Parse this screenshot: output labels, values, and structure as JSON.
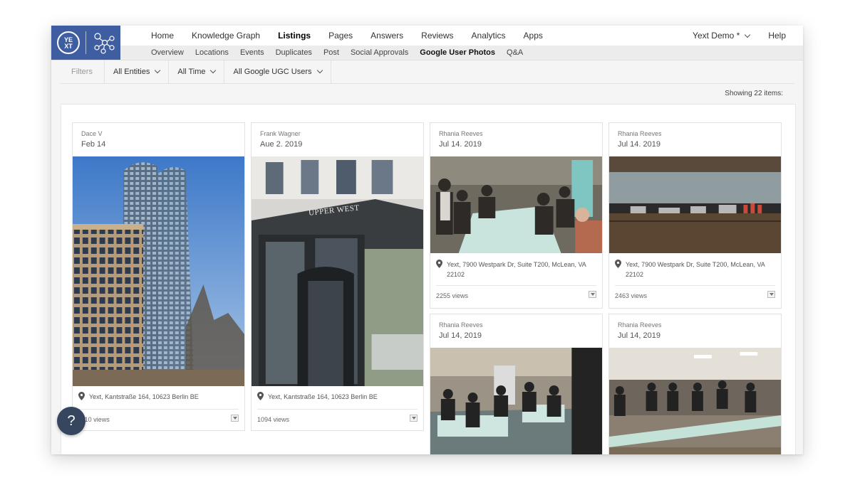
{
  "nav": {
    "main": [
      "Home",
      "Knowledge Graph",
      "Listings",
      "Pages",
      "Answers",
      "Reviews",
      "Analytics",
      "Apps"
    ],
    "active_main": "Listings",
    "sub": [
      "Overview",
      "Locations",
      "Events",
      "Duplicates",
      "Post",
      "Social Approvals",
      "Google User Photos",
      "Q&A"
    ],
    "active_sub": "Google User Photos",
    "account": "Yext Demo *",
    "help": "Help"
  },
  "filters": {
    "label": "Filters",
    "entities": "All Entities",
    "time": "All Time",
    "users": "All Google UGC Users"
  },
  "showing": "Showing 22 items:",
  "cards": [
    {
      "author": "Dace V",
      "date": "Feb 14",
      "location": "Yext, Kantstraße 164, 10623 Berlin BE",
      "views": "1110 views"
    },
    {
      "author": "Frank Wagner",
      "date": "Aue 2. 2019",
      "location": "Yext, Kantstraße 164, 10623 Berlin BE",
      "views": "1094 views",
      "sign_text": "UPPER WEST"
    },
    {
      "author": "Rhania Reeves",
      "date": "Jul 14. 2019",
      "location": "Yext, 7900 Westpark Dr, Suite T200, McLean, VA 22102",
      "views": "2255 views"
    },
    {
      "author": "Rhania Reeves",
      "date": "Jul 14. 2019",
      "location": "Yext, 7900 Westpark Dr, Suite T200, McLean, VA 22102",
      "views": "2463 views"
    },
    {
      "author": "Rhania Reeves",
      "date": "Jul 14, 2019"
    },
    {
      "author": "Rhania Reeves",
      "date": "Jul 14, 2019"
    }
  ],
  "fab": "?",
  "logo_text": "YEXT"
}
